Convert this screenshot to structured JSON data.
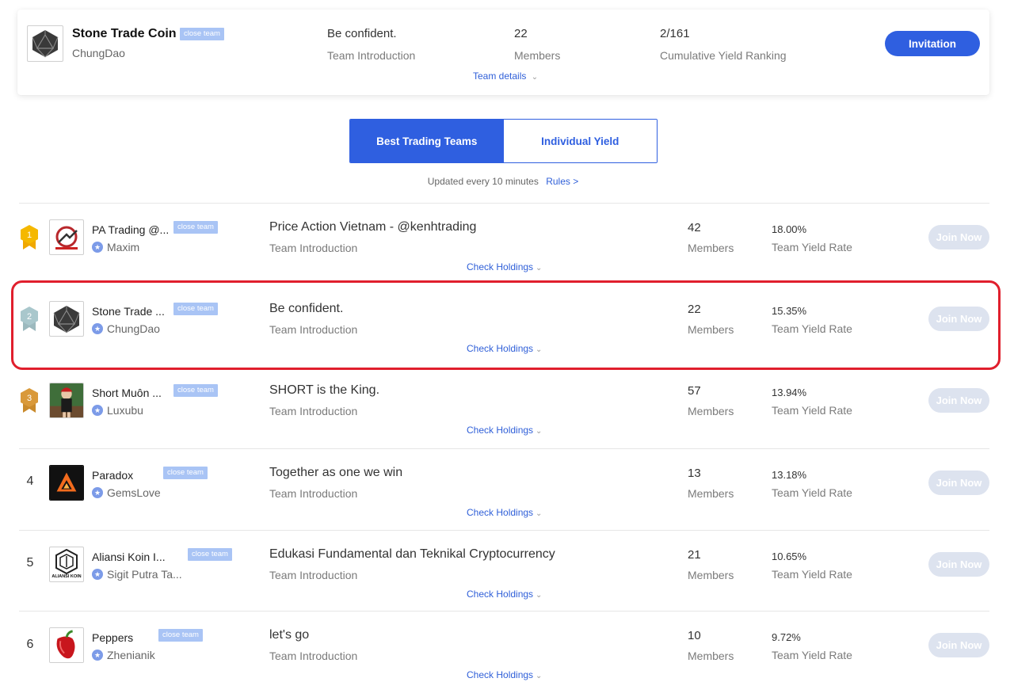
{
  "team": {
    "name": "Stone Trade Coin",
    "badge": "close team",
    "leader": "ChungDao",
    "intro": "Be confident.",
    "intro_label": "Team Introduction",
    "members": "22",
    "members_label": "Members",
    "ranking": "2/161",
    "ranking_label": "Cumulative Yield Ranking",
    "details_link": "Team details",
    "invite_label": "Invitation"
  },
  "tabs": [
    {
      "label": "Best Trading Teams",
      "active": true
    },
    {
      "label": "Individual Yield",
      "active": false
    }
  ],
  "update_note": "Updated every 10 minutes",
  "rules_link": "Rules >",
  "teams": [
    {
      "rank": "1",
      "name": "PA Trading @...",
      "badge": "close team",
      "leader": "Maxim",
      "intro": "Price Action Vietnam - @kenhtrading",
      "intro_label": "Team Introduction",
      "holdings": "Check Holdings",
      "members": "42",
      "members_label": "Members",
      "yield": "18.00%",
      "yield_label": "Team Yield Rate",
      "join": "Join Now",
      "avatar": "kenhtrading-logo"
    },
    {
      "rank": "2",
      "name": "Stone Trade ...",
      "badge": "close team",
      "leader": "ChungDao",
      "intro": "Be confident.",
      "intro_label": "Team Introduction",
      "holdings": "Check Holdings",
      "members": "22",
      "members_label": "Members",
      "yield": "15.35%",
      "yield_label": "Team Yield Rate",
      "join": "Join Now",
      "avatar": "stone-logo"
    },
    {
      "rank": "3",
      "name": "Short Muôn ...",
      "badge": "close team",
      "leader": "Luxubu",
      "intro": "SHORT is the King.",
      "intro_label": "Team Introduction",
      "holdings": "Check Holdings",
      "members": "57",
      "members_label": "Members",
      "yield": "13.94%",
      "yield_label": "Team Yield Rate",
      "join": "Join Now",
      "avatar": "user-photo"
    },
    {
      "rank": "4",
      "name": "Paradox",
      "badge": "close team",
      "leader": "GemsLove",
      "intro": "Together as one we win",
      "intro_label": "Team Introduction",
      "holdings": "Check Holdings",
      "members": "13",
      "members_label": "Members",
      "yield": "13.18%",
      "yield_label": "Team Yield Rate",
      "join": "Join Now",
      "avatar": "paradox-logo"
    },
    {
      "rank": "5",
      "name": "Aliansi Koin I...",
      "badge": "close team",
      "leader": "Sigit Putra Ta...",
      "intro": "Edukasi Fundamental dan Teknikal Cryptocurrency",
      "intro_label": "Team Introduction",
      "holdings": "Check Holdings",
      "members": "21",
      "members_label": "Members",
      "yield": "10.65%",
      "yield_label": "Team Yield Rate",
      "join": "Join Now",
      "avatar": "aliansi-koin-logo",
      "avatar_text": "ALIANSI KOIN"
    },
    {
      "rank": "6",
      "name": "Peppers",
      "badge": "close team",
      "leader": "Zhenianik",
      "intro": "let's go",
      "intro_label": "Team Introduction",
      "holdings": "Check Holdings",
      "members": "10",
      "members_label": "Members",
      "yield": "9.72%",
      "yield_label": "Team Yield Rate",
      "join": "Join Now",
      "avatar": "pepper-image"
    }
  ],
  "colors": {
    "accent": "#2f5fe0",
    "badge": "#a9c4f5",
    "highlight": "#e01f2d",
    "gold": "#f5b800",
    "silver": "#a9c7cc",
    "bronze": "#d9993a"
  }
}
